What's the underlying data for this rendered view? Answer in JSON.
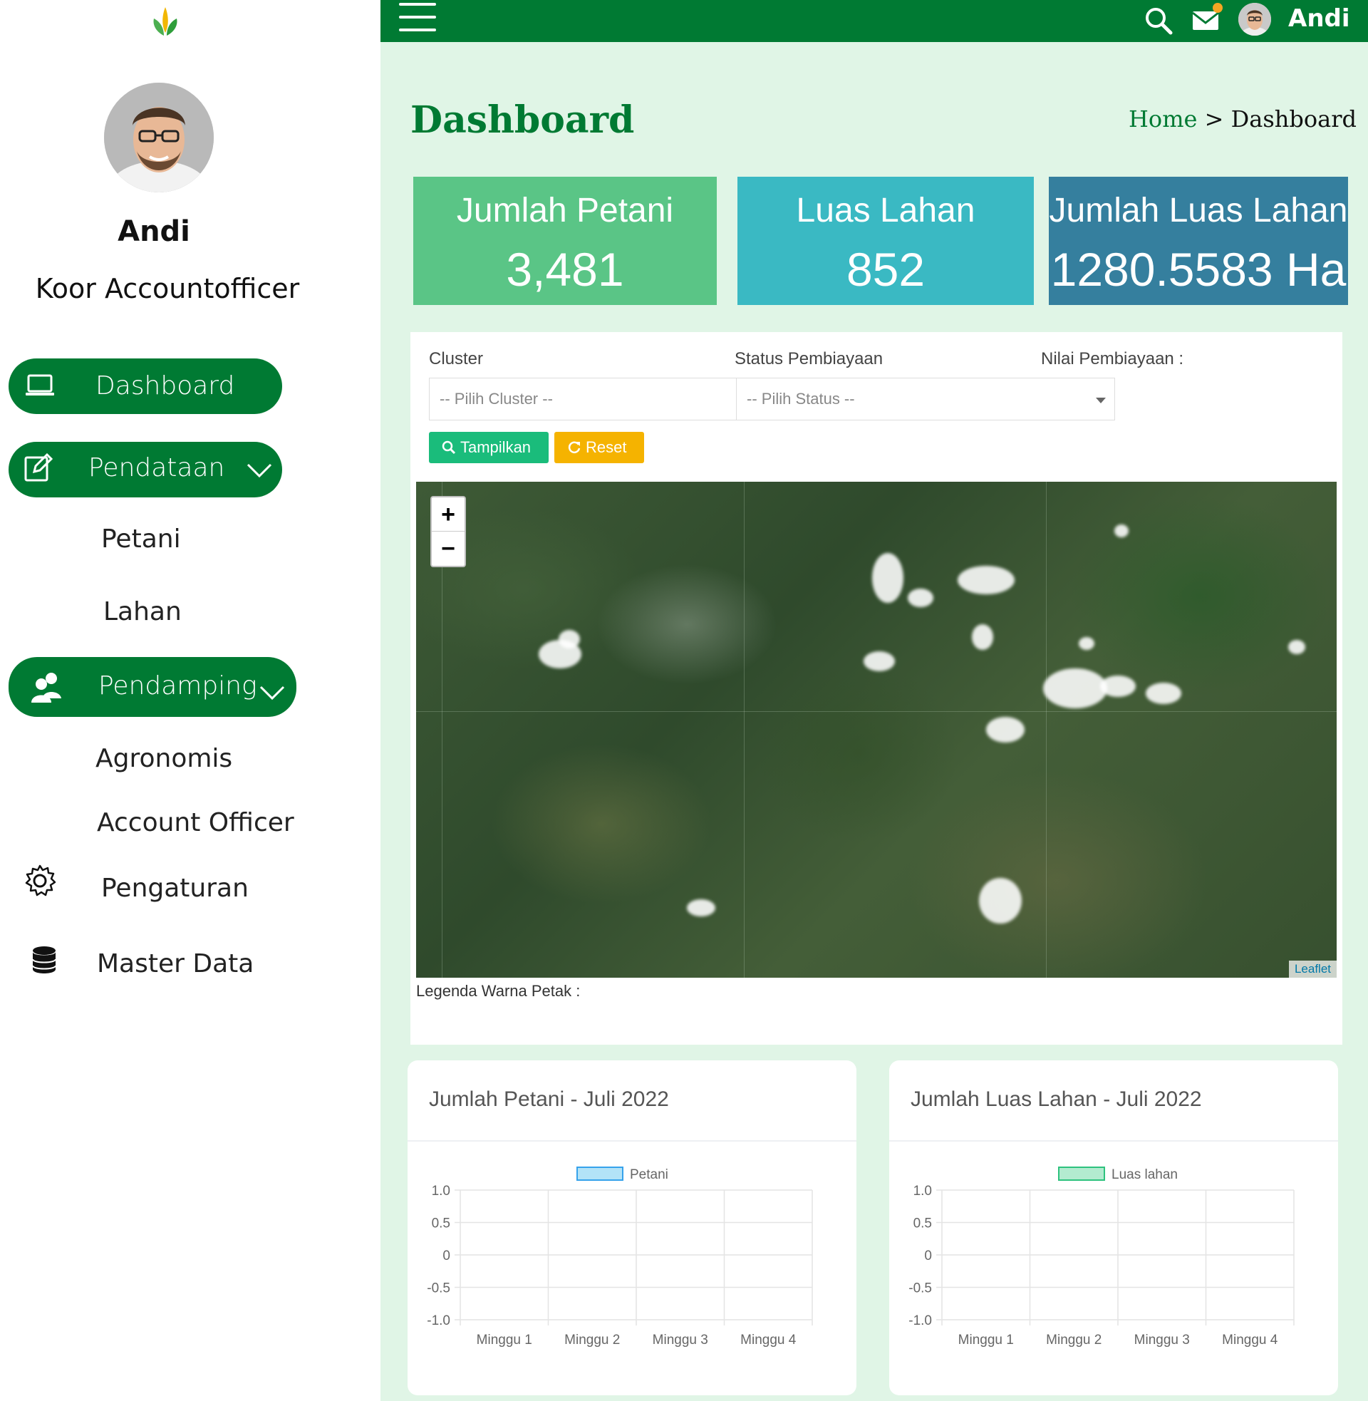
{
  "sidebar": {
    "user_name": "Andi",
    "user_role": "Koor Accountofficer",
    "items": [
      {
        "label": "Dashboard"
      },
      {
        "label": "Pendataan",
        "children": [
          "Petani",
          "Lahan"
        ]
      },
      {
        "label": "Pendamping",
        "children": [
          "Agronomis",
          "Account Officer"
        ]
      },
      {
        "label": "Pengaturan"
      },
      {
        "label": "Master Data"
      }
    ]
  },
  "topbar": {
    "user_name": "Andi"
  },
  "header": {
    "title": "Dashboard",
    "breadcrumb_home": "Home",
    "breadcrumb_separator": ">",
    "breadcrumb_current": "Dashboard"
  },
  "stats": [
    {
      "label": "Jumlah Petani",
      "value": "3,481",
      "color": "#5ac586"
    },
    {
      "label": "Luas Lahan",
      "value": "852",
      "color": "#3ab9c3"
    },
    {
      "label": "Jumlah Luas Lahan",
      "value": "1280.5583 Ha",
      "color": "#357f9e"
    }
  ],
  "filters": {
    "cluster_label": "Cluster",
    "cluster_placeholder": "-- Pilih Cluster --",
    "status_label": "Status Pembiayaan",
    "status_placeholder": "-- Pilih Status --",
    "nilai_label": "Nilai Pembiayaan :",
    "btn_show": "Tampilkan",
    "btn_reset": "Reset"
  },
  "map": {
    "zoom_in": "+",
    "zoom_out": "−",
    "attribution": "Leaflet",
    "legend_label": "Legenda Warna Petak :"
  },
  "colors": {
    "brand_green": "#007a33",
    "main_bg": "#e0f5e6",
    "btn_show": "#1abc7b",
    "btn_reset": "#f5b300"
  },
  "chart_data": [
    {
      "type": "bar",
      "title": "Jumlah Petani - Juli 2022",
      "categories": [
        "Minggu 1",
        "Minggu 2",
        "Minggu 3",
        "Minggu 4"
      ],
      "series": [
        {
          "name": "Petani",
          "values": [],
          "color": "#b3e3f7",
          "border": "#36a2eb"
        }
      ],
      "yticks": [
        "1.0",
        "0.5",
        "0",
        "-0.5",
        "-1.0"
      ],
      "ylim": [
        -1,
        1
      ],
      "grid": true,
      "legend": "top"
    },
    {
      "type": "bar",
      "title": "Jumlah Luas Lahan - Juli 2022",
      "categories": [
        "Minggu 1",
        "Minggu 2",
        "Minggu 3",
        "Minggu 4"
      ],
      "series": [
        {
          "name": "Luas lahan",
          "values": [],
          "color": "#b3ebd0",
          "border": "#2ec27e"
        }
      ],
      "yticks": [
        "1.0",
        "0.5",
        "0",
        "-0.5",
        "-1.0"
      ],
      "ylim": [
        -1,
        1
      ],
      "grid": true,
      "legend": "top"
    }
  ]
}
